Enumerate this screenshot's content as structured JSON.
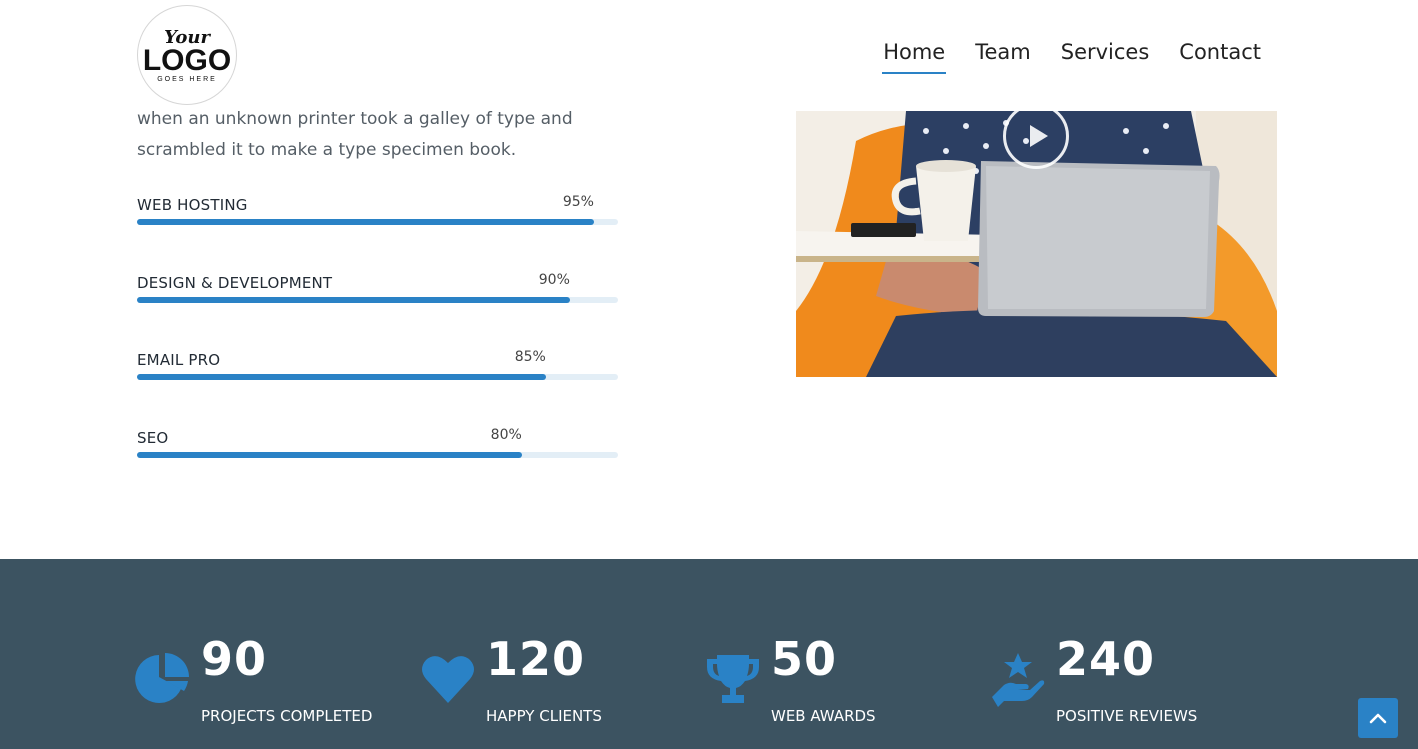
{
  "logo": {
    "line1": "Your",
    "line2": "LOGO",
    "line3": "GOES HERE"
  },
  "nav": {
    "items": [
      {
        "label": "Home",
        "active": true
      },
      {
        "label": "Team",
        "active": false
      },
      {
        "label": "Services",
        "active": false
      },
      {
        "label": "Contact",
        "active": false
      }
    ]
  },
  "intro": {
    "line1": "when an unknown printer took a galley of type and",
    "line2": "scrambled it to make a type specimen book."
  },
  "skills": [
    {
      "label": "WEB HOSTING",
      "percent_text": "95%",
      "value": 95
    },
    {
      "label": "DESIGN & DEVELOPMENT",
      "percent_text": "90%",
      "value": 90
    },
    {
      "label": "EMAIL PRO",
      "percent_text": "85%",
      "value": 85
    },
    {
      "label": "SEO",
      "percent_text": "80%",
      "value": 80
    }
  ],
  "video": {
    "icon": "play-icon"
  },
  "stats": [
    {
      "number": "90",
      "caption": "PROJECTS COMPLETED",
      "icon": "pie-chart-icon"
    },
    {
      "number": "120",
      "caption": "HAPPY CLIENTS",
      "icon": "heart-icon"
    },
    {
      "number": "50",
      "caption": "WEB AWARDS",
      "icon": "trophy-icon"
    },
    {
      "number": "240",
      "caption": "POSITIVE REVIEWS",
      "icon": "hand-star-icon"
    }
  ],
  "colors": {
    "accent": "#2a82c6",
    "band": "#3c5361",
    "track": "#e3eef6"
  },
  "scroll_top": {
    "icon": "chevron-up-icon"
  }
}
